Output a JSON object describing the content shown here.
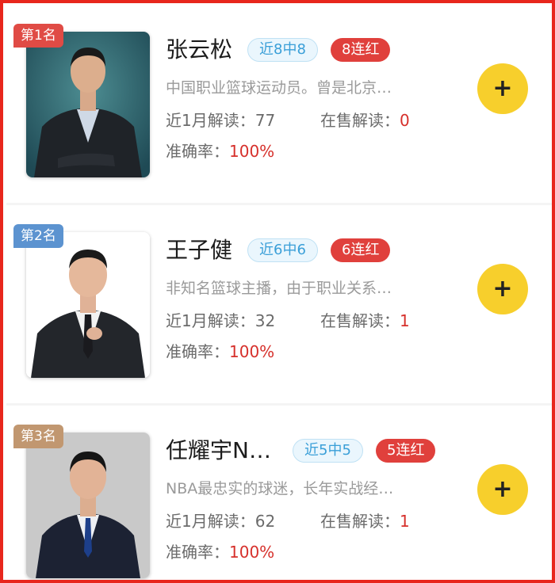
{
  "colors": {
    "border": "#e8261d",
    "rank1": "#e04b45",
    "rank2": "#5c93d0",
    "rank3": "#c19770",
    "follow": "#f7cf2c",
    "streak": "#e0403c",
    "record_text": "#3a9fd8",
    "red_value": "#d6302b"
  },
  "experts": [
    {
      "rank": "第1名",
      "name": "张云松",
      "record": "近8中8",
      "streak": "8连红",
      "desc": "中国职业篮球运动员。曾是北京…",
      "month_label": "近1月解读：",
      "month_value": "77",
      "sale_label": "在售解读：",
      "sale_value": "0",
      "acc_label": "准确率：",
      "acc_value": "100%",
      "follow_icon": "plus-icon"
    },
    {
      "rank": "第2名",
      "name": "王子健",
      "record": "近6中6",
      "streak": "6连红",
      "desc": "非知名篮球主播，由于职业关系…",
      "month_label": "近1月解读：",
      "month_value": "32",
      "sale_label": "在售解读：",
      "sale_value": "1",
      "acc_label": "准确率：",
      "acc_value": "100%",
      "follow_icon": "plus-icon"
    },
    {
      "rank": "第3名",
      "name": "任耀宇N…",
      "record": "近5中5",
      "streak": "5连红",
      "desc": "NBA最忠实的球迷，长年实战经…",
      "month_label": "近1月解读：",
      "month_value": "62",
      "sale_label": "在售解读：",
      "sale_value": "1",
      "acc_label": "准确率：",
      "acc_value": "100%",
      "follow_icon": "plus-icon"
    }
  ]
}
